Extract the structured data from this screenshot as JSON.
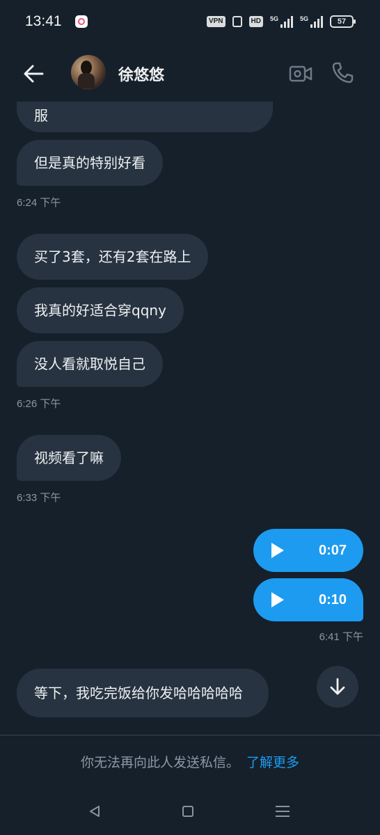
{
  "status_bar": {
    "time": "13:41",
    "vpn_label": "VPN",
    "hd_label": "HD",
    "signal1_label": "5G",
    "signal2_label": "5G",
    "battery": "57"
  },
  "header": {
    "contact_name": "徐悠悠",
    "back_icon": "arrow-left-icon",
    "video_icon": "video-camera-icon",
    "call_icon": "phone-icon"
  },
  "messages": {
    "m0": "服",
    "m1": "但是真的特别好看",
    "t1": "6:24 下午",
    "m2": "买了3套，还有2套在路上",
    "m3": "我真的好适合穿qqny",
    "m4": "没人看就取悦自己",
    "t2": "6:26 下午",
    "m5": "视频看了嘛",
    "t3": "6:33 下午",
    "voice1": "0:07",
    "voice2": "0:10",
    "t4": "6:41 下午",
    "m6": "等下，我吃完饭给你发哈哈哈哈哈"
  },
  "notice": {
    "text": "你无法再向此人发送私信。",
    "link": "了解更多"
  },
  "colors": {
    "background": "#15202b",
    "bubble_incoming": "#273340",
    "bubble_outgoing": "#1d9bf0",
    "timestamp": "#8b98a5",
    "link": "#1d9bf0"
  }
}
